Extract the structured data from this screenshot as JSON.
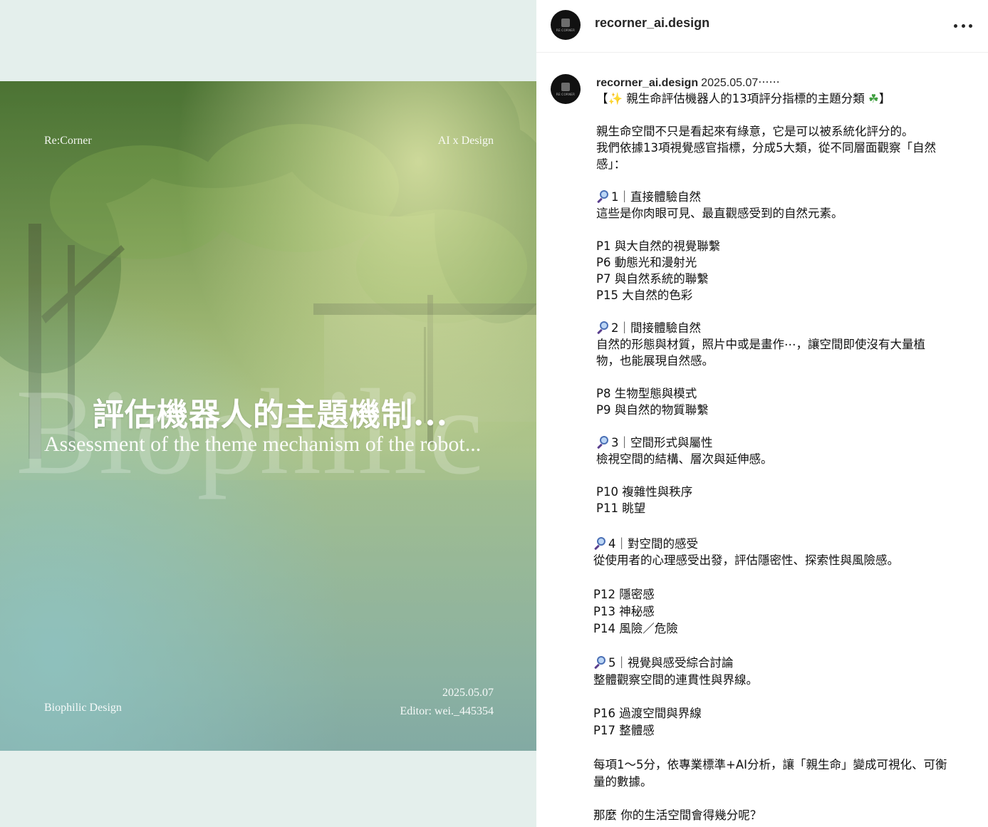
{
  "poster": {
    "brand_left": "Re:Corner",
    "brand_right": "AI x Design",
    "watermark": "Biophilic",
    "title": "評估機器人的主題機制...",
    "subtitle": "Assessment of the theme mechanism of the robot...",
    "footer_left": "Biophilic Design",
    "date": "2025.05.07",
    "editor": "Editor: wei._445354"
  },
  "post": {
    "username": "recorner_ai.design",
    "avatar_text": "RE:CORNER",
    "more_icon": "more-horizontal-icon",
    "caption_user": "recorner_ai.design",
    "caption_date": "2025.05.07‧‧‧‧‧‧",
    "headline_open": "【",
    "headline_text": " 親生命評估機器人的13項評分指標的主題分類 ",
    "headline_close": "】",
    "intro1": "親生命空間不只是看起來有綠意，它是可以被系統化評分的。",
    "intro2": "我們依據13項視覺感官指標，分成5大類，從不同層面觀察「自然",
    "intro3": "感」：",
    "s1_title": "1｜直接體驗自然",
    "s1_desc": "這些是你肉眼可見、最直觀感受到的自然元素。",
    "s1_items": [
      "P1 與大自然的視覺聯繫",
      "P6 動態光和漫射光",
      "P7 與自然系統的聯繫",
      "P15 大自然的色彩"
    ],
    "s2_title": "2｜間接體驗自然",
    "s2_desc1": "自然的形態與材質，照片中或是畫作⋯，讓空間即使沒有大量植",
    "s2_desc2": "物，也能展現自然感。",
    "s2_items": [
      "P8 生物型態與模式",
      "P9 與自然的物質聯繫"
    ],
    "s3_title": "3｜空間形式與屬性",
    "s3_desc": "檢視空間的結構、層次與延伸感。",
    "s3_items": [
      "P10 複雜性與秩序",
      "P11 眺望"
    ],
    "s4_title": "4｜對空間的感受",
    "s4_desc": "從使用者的心理感受出發，評估隱密性、探索性與風險感。",
    "s4_items": [
      "P12 隱密感",
      "P13 神秘感",
      "P14 風險／危險"
    ],
    "s5_title": "5｜視覺與感受綜合討論",
    "s5_desc": "整體觀察空間的連貫性與界線。",
    "s5_items": [
      "P16 過渡空間與界線",
      "P17 整體感"
    ],
    "outro1": "每項1～5分，依專業標準+AI分析，讓「親生命」變成可視化、可衡",
    "outro2": "量的數據。",
    "question": "那麼 你的生活空間會得幾分呢？"
  },
  "colors": {
    "page_bg": "#e4efec",
    "poster_top": "#5b7f3e",
    "poster_bottom": "#70989a",
    "text": "#111111"
  },
  "icons": {
    "sparkle": "sparkles-icon",
    "clover": "shamrock-icon",
    "section": "magnifying-glass-icon"
  }
}
